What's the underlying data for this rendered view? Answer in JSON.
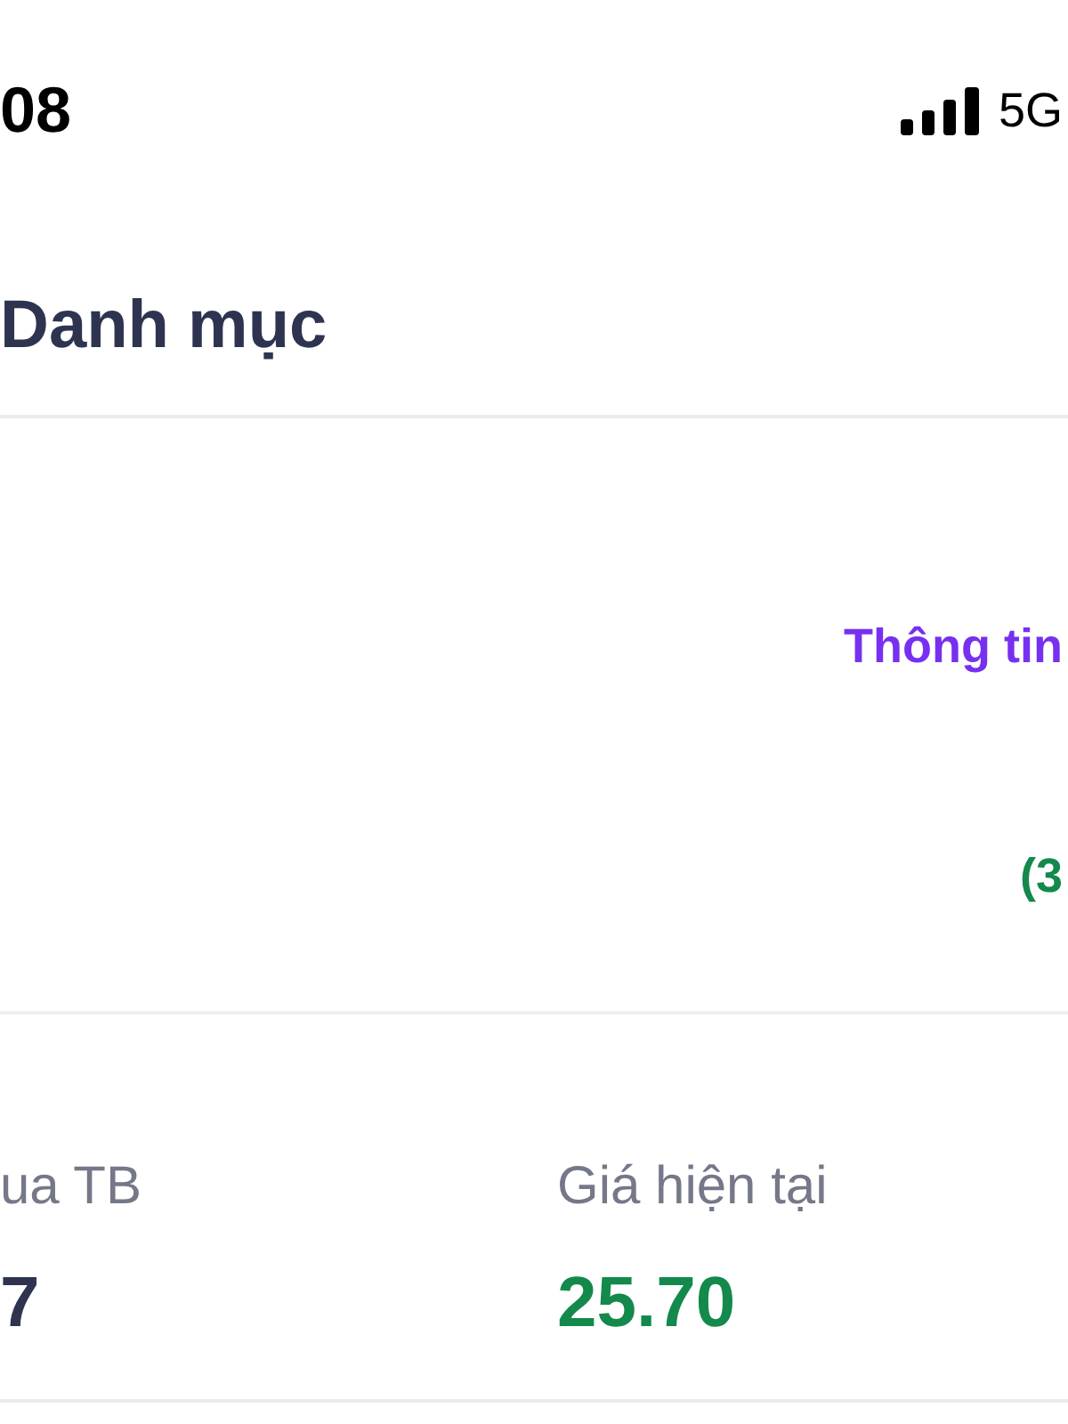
{
  "status_bar": {
    "time": "08",
    "network": "5G"
  },
  "header": {
    "title": "Danh mục"
  },
  "panel": {
    "link": "Thông tin",
    "value": "(3"
  },
  "stats": [
    {
      "label": "ua TB",
      "value": "7",
      "kind": "neutral"
    },
    {
      "label": "Giá hiện tại",
      "value": "25.70",
      "kind": "up"
    }
  ]
}
